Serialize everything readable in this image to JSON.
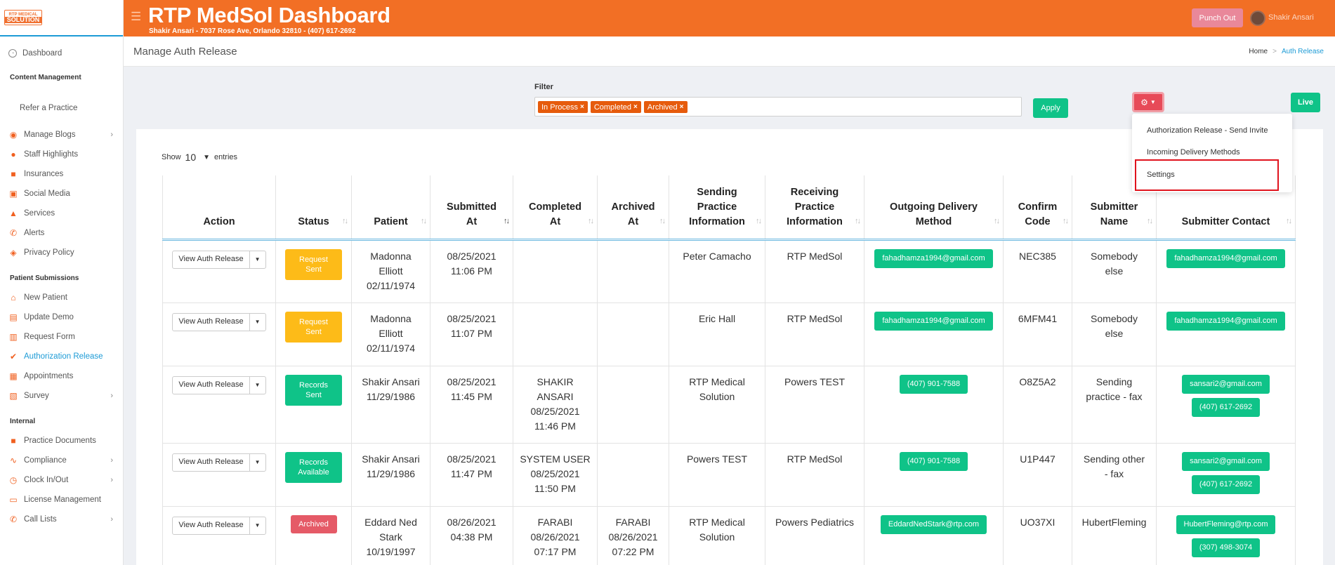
{
  "header": {
    "title": "RTP MedSol Dashboard",
    "subtitle": "Shakir Ansari - 7037 Rose Ave, Orlando 32810 - (407) 617-2692",
    "punch_out": "Punch Out",
    "user_name": "Shakir Ansari",
    "accent": "#f26f25"
  },
  "logo": {
    "top": "RTP MEDICAL",
    "bottom": "SOLUTION"
  },
  "sidebar": {
    "dashboard": "Dashboard",
    "content_management": "Content Management",
    "refer": "Refer a Practice",
    "manage_blogs": "Manage Blogs",
    "staff_highlights": "Staff Highlights",
    "insurances": "Insurances",
    "social_media": "Social Media",
    "services": "Services",
    "alerts": "Alerts",
    "privacy_policy": "Privacy Policy",
    "patient_submissions": "Patient Submissions",
    "new_patient": "New Patient",
    "update_demo": "Update Demo",
    "request_form": "Request Form",
    "authorization_release": "Authorization Release",
    "appointments": "Appointments",
    "survey": "Survey",
    "internal": "Internal",
    "practice_documents": "Practice Documents",
    "compliance": "Compliance",
    "clock_in_out": "Clock In/Out",
    "license_management": "License Management",
    "call_lists": "Call Lists"
  },
  "page": {
    "title": "Manage Auth Release",
    "breadcrumb_home": "Home",
    "breadcrumb_current": "Auth Release"
  },
  "filter": {
    "label": "Filter",
    "chips": [
      "In Process",
      "Completed",
      "Archived"
    ],
    "apply": "Apply"
  },
  "toolbar": {
    "live": "Live"
  },
  "menu": {
    "items": [
      "Authorization Release - Send Invite",
      "Incoming Delivery Methods",
      "Settings"
    ]
  },
  "entries": {
    "show": "Show",
    "value": "10",
    "entries": "entries"
  },
  "table": {
    "headers": {
      "action": "Action",
      "status": "Status",
      "patient": "Patient",
      "submitted_1": "Submitted",
      "submitted_2": "At",
      "completed_1": "Completed",
      "completed_2": "At",
      "archived_1": "Archived",
      "archived_2": "At",
      "sending_1": "Sending",
      "sending_2": "Practice",
      "sending_3": "Information",
      "receiving_1": "Receiving",
      "receiving_2": "Practice",
      "receiving_3": "Information",
      "outgoing_1": "Outgoing Delivery",
      "outgoing_2": "Method",
      "confirm_1": "Confirm",
      "confirm_2": "Code",
      "submitter_1": "Submitter",
      "submitter_2": "Name",
      "contact": "Submitter Contact"
    },
    "action_label": "View Auth Release",
    "rows": [
      {
        "status_1": "Request",
        "status_2": "Sent",
        "patient_1": "Madonna",
        "patient_2": "Elliott",
        "patient_3": "02/11/1974",
        "sub_1": "08/25/2021",
        "sub_2": "11:06 PM",
        "comp_1": "",
        "comp_2": "",
        "comp_3": "",
        "arch_1": "",
        "arch_2": "",
        "arch_3": "",
        "sending": "Peter Camacho",
        "receiving": "RTP MedSol",
        "outgoing": "fahadhamza1994@gmail.com",
        "code": "NEC385",
        "submitter_1": "Somebody",
        "submitter_2": "else",
        "contact_1": "fahadhamza1994@gmail.com",
        "contact_2": ""
      },
      {
        "status_1": "Request",
        "status_2": "Sent",
        "patient_1": "Madonna",
        "patient_2": "Elliott",
        "patient_3": "02/11/1974",
        "sub_1": "08/25/2021",
        "sub_2": "11:07 PM",
        "comp_1": "",
        "comp_2": "",
        "comp_3": "",
        "arch_1": "",
        "arch_2": "",
        "arch_3": "",
        "sending": "Eric Hall",
        "receiving": "RTP MedSol",
        "outgoing": "fahadhamza1994@gmail.com",
        "code": "6MFM41",
        "submitter_1": "Somebody",
        "submitter_2": "else",
        "contact_1": "fahadhamza1994@gmail.com",
        "contact_2": ""
      },
      {
        "status_1": "Records",
        "status_2": "Sent",
        "patient_1": "Shakir Ansari",
        "patient_2": "11/29/1986",
        "patient_3": "",
        "sub_1": "08/25/2021",
        "sub_2": "11:45 PM",
        "comp_1": "SHAKIR",
        "comp_2": "ANSARI",
        "comp_3": "08/25/2021",
        "comp_4": "11:46 PM",
        "arch_1": "",
        "arch_2": "",
        "arch_3": "",
        "sending_1": "RTP Medical",
        "sending_2": "Solution",
        "receiving": "Powers TEST",
        "outgoing": "(407) 901-7588",
        "code": "O8Z5A2",
        "submitter_1": "Sending",
        "submitter_2": "practice - fax",
        "contact_1": "sansari2@gmail.com",
        "contact_2": "(407) 617-2692"
      },
      {
        "status_1": "Records",
        "status_2": "Available",
        "patient_1": "Shakir Ansari",
        "patient_2": "11/29/1986",
        "patient_3": "",
        "sub_1": "08/25/2021",
        "sub_2": "11:47 PM",
        "comp_1": "SYSTEM USER",
        "comp_2": "08/25/2021",
        "comp_3": "11:50 PM",
        "arch_1": "",
        "arch_2": "",
        "arch_3": "",
        "sending": "Powers TEST",
        "receiving": "RTP MedSol",
        "outgoing": "(407) 901-7588",
        "code": "U1P447",
        "submitter_1": "Sending other",
        "submitter_2": "- fax",
        "contact_1": "sansari2@gmail.com",
        "contact_2": "(407) 617-2692"
      },
      {
        "status": "Archived",
        "patient_1": "Eddard Ned",
        "patient_2": "Stark",
        "patient_3": "10/19/1997",
        "sub_1": "08/26/2021",
        "sub_2": "04:38 PM",
        "comp_1": "FARABI",
        "comp_2": "08/26/2021",
        "comp_3": "07:17 PM",
        "arch_1": "FARABI",
        "arch_2": "08/26/2021",
        "arch_3": "07:22 PM",
        "sending_1": "RTP Medical",
        "sending_2": "Solution",
        "receiving": "Powers Pediatrics",
        "outgoing": "EddardNedStark@rtp.com",
        "code": "UO37XI",
        "submitter": "HubertFleming",
        "contact_1": "HubertFleming@rtp.com",
        "contact_2": "(307) 498-3074"
      }
    ]
  }
}
